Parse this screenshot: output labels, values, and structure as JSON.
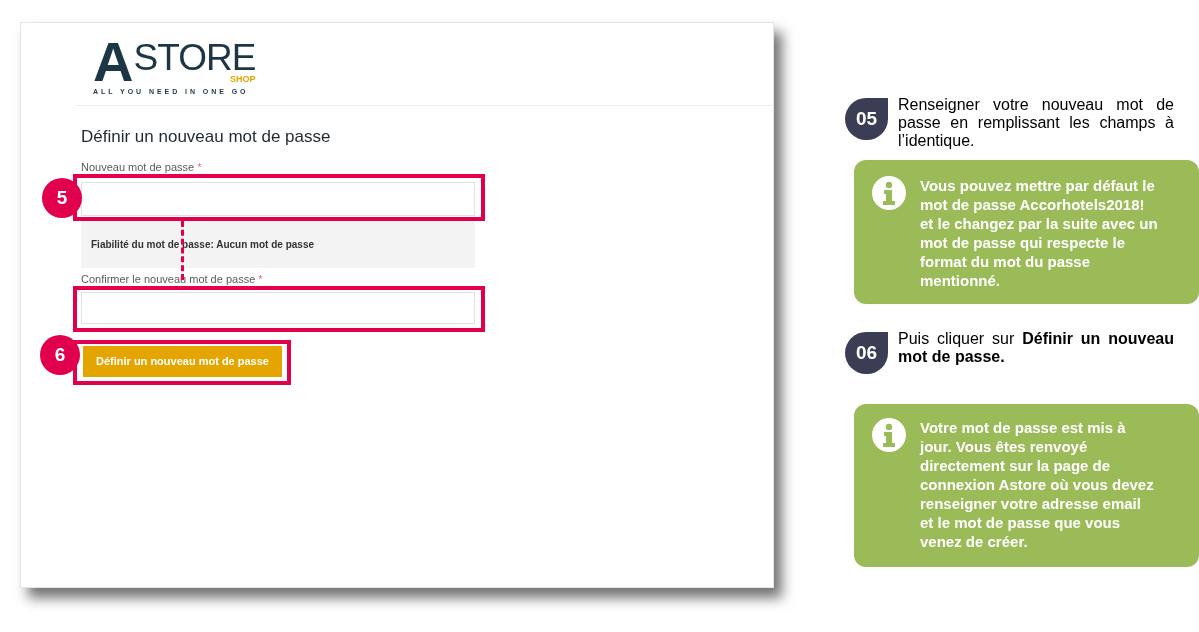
{
  "screenshot": {
    "logo": {
      "initial": "A",
      "word": "STORE",
      "sub": "SHOP",
      "tagline": "ALL YOU NEED IN ONE GO"
    },
    "title": "Définir un nouveau mot de passe",
    "fields": [
      {
        "label": "Nouveau mot de passe",
        "required_mark": "*"
      },
      {
        "label": "Confirmer le nouveau mot de passe",
        "required_mark": "*"
      }
    ],
    "strength": "Fiabilité du mot de passe: Aucun mot de passe",
    "button": "Définir un nouveau mot de passe",
    "markers": [
      "5",
      "6"
    ]
  },
  "steps": [
    {
      "number": "05",
      "text": "Renseigner votre nouveau mot de passe en remplissant les champs à l’identique.",
      "note": "Vous pouvez mettre par défaut le\nmot de passe Accorhotels2018!\net le changez par la suite avec un\nmot de passe qui respecte le\nformat du mot du passe\nmentionné."
    },
    {
      "number": "06",
      "text": "Puis cliquer sur **Définir un nouveau mot de passe.**",
      "note": "Votre mot de passe est mis à\njour. Vous êtes renvoyé\ndirectement sur la page de\nconnexion Astore où vous devez\nrenseigner votre adresse  email\net le mot de passe que vous\nvenez de créer."
    }
  ]
}
